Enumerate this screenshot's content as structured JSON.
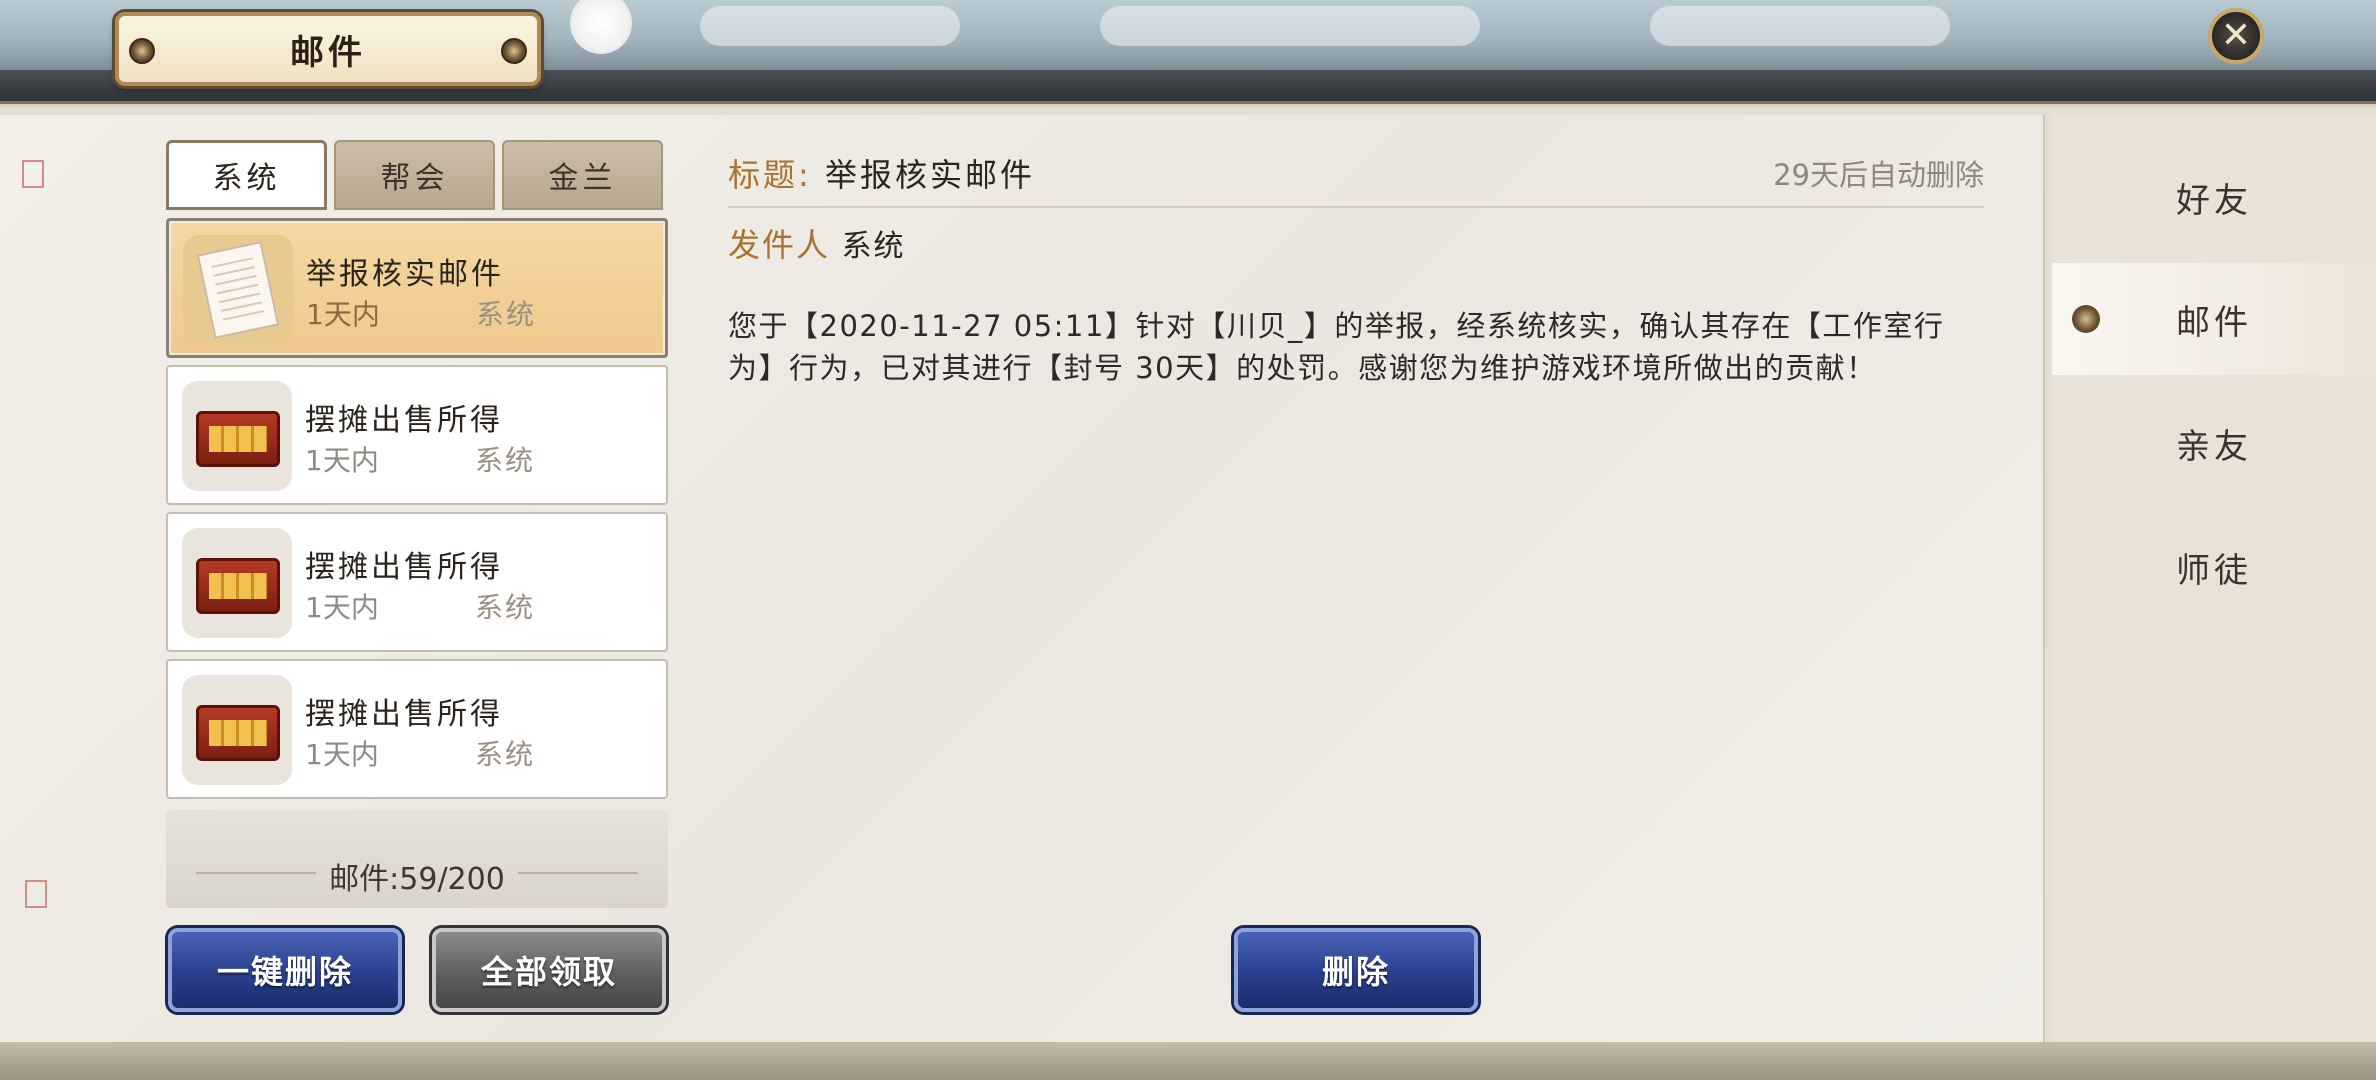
{
  "header": {
    "title": "邮件",
    "close_icon": "close-icon"
  },
  "tabs": [
    {
      "label": "系统",
      "active": true
    },
    {
      "label": "帮会",
      "active": false
    },
    {
      "label": "金兰",
      "active": false
    }
  ],
  "mail_list": [
    {
      "title": "举报核实邮件",
      "time": "1天内",
      "from": "系统",
      "icon": "document-icon",
      "selected": true
    },
    {
      "title": "摆摊出售所得",
      "time": "1天内",
      "from": "系统",
      "icon": "treasure-chest-icon",
      "selected": false
    },
    {
      "title": "摆摊出售所得",
      "time": "1天内",
      "from": "系统",
      "icon": "treasure-chest-icon",
      "selected": false
    },
    {
      "title": "摆摊出售所得",
      "time": "1天内",
      "from": "系统",
      "icon": "treasure-chest-icon",
      "selected": false
    }
  ],
  "counter": "邮件:59/200",
  "buttons": {
    "delete_all": "一键删除",
    "claim_all": "全部领取",
    "delete": "删除"
  },
  "detail": {
    "subject_label": "标题:",
    "subject": "举报核实邮件",
    "auto_delete": "29天后自动删除",
    "sender_label": "发件人",
    "sender": "系统",
    "body": "您于【2020-11-27 05:11】针对【川贝_】的举报，经系统核实，确认其存在【工作室行为】行为，已对其进行【封号 30天】的处罚。感谢您为维护游戏环境所做出的贡献！"
  },
  "sidebar": [
    {
      "label": "好友",
      "active": false
    },
    {
      "label": "邮件",
      "active": true
    },
    {
      "label": "亲友",
      "active": false
    },
    {
      "label": "师徒",
      "active": false
    }
  ],
  "colors": {
    "accent_gold": "#a7742f",
    "selected_item": "#f2d09a",
    "button_blue": "#2a3f8e",
    "button_gray": "#5f5f5f"
  }
}
